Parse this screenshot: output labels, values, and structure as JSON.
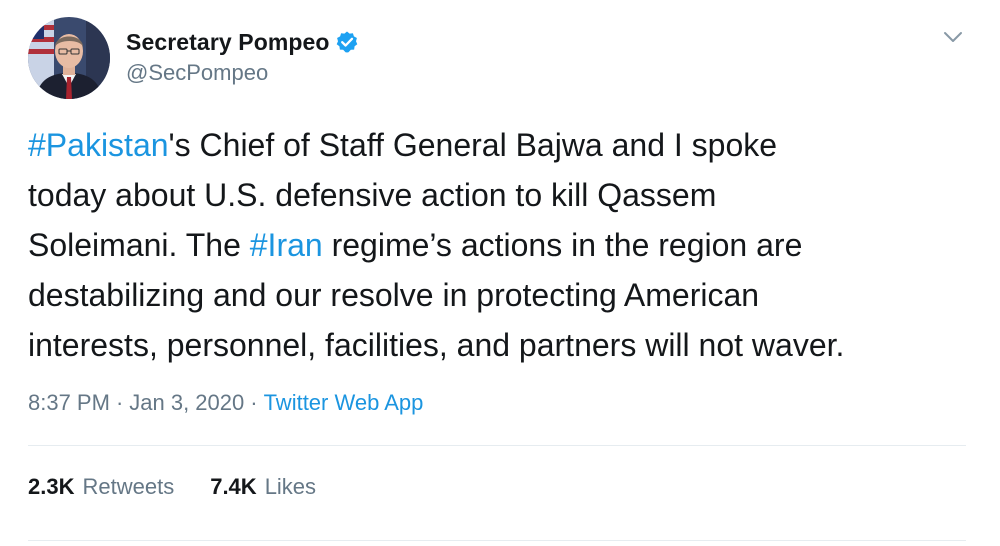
{
  "tweet": {
    "author": {
      "display_name": "Secretary Pompeo",
      "handle": "@SecPompeo",
      "verified": true
    },
    "text_lines": [
      [
        {
          "text": "#Pakistan",
          "hashtag": true
        },
        {
          "text": "'s Chief of Staff General Bajwa and I spoke",
          "hashtag": false
        }
      ],
      [
        {
          "text": "today about U.S. defensive action to kill Qassem",
          "hashtag": false
        }
      ],
      [
        {
          "text": "Soleimani. The ",
          "hashtag": false
        },
        {
          "text": "#Iran",
          "hashtag": true
        },
        {
          "text": " regime’s actions in the region are",
          "hashtag": false
        }
      ],
      [
        {
          "text": "destabilizing and our resolve in protecting American",
          "hashtag": false
        }
      ],
      [
        {
          "text": "interests, personnel, facilities, and partners will not waver.",
          "hashtag": false
        }
      ]
    ],
    "meta": {
      "time": "8:37 PM",
      "separator": "·",
      "date": "Jan 3, 2020",
      "source": "Twitter Web App"
    },
    "stats": {
      "retweets_count": "2.3K",
      "retweets_label": "Retweets",
      "likes_count": "7.4K",
      "likes_label": "Likes"
    }
  },
  "colors": {
    "link": "#1b95e0",
    "secondary_text": "#657786",
    "primary_text": "#14171a",
    "divider": "#e6ecf0",
    "verified": "#1da1f2"
  },
  "icons": {
    "verified": "verified-badge-icon",
    "menu": "chevron-down-icon"
  }
}
